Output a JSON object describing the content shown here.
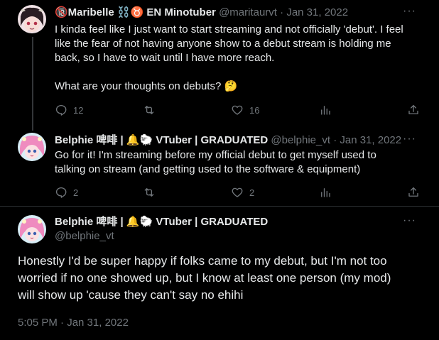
{
  "tweets": [
    {
      "display_name": "🔞Maribelle ⛓️♉ EN Minotuber",
      "handle": "@maritaurvt",
      "date": "Jan 31, 2022",
      "text_lines": [
        "I kinda feel like I just want to start streaming and not officially 'debut'. I feel",
        "like the fear of not having anyone show to a debut stream is holding me",
        "back, so I have to wait until I have more reach."
      ],
      "text_line2": "What are your thoughts on debuts? 🤔",
      "replies": "12",
      "retweets": "",
      "likes": "16",
      "views": ""
    },
    {
      "display_name": "Belphie 啤啡 | 🔔🐑 VTuber | GRADUATED",
      "handle": "@belphie_vt",
      "date": "Jan 31, 2022",
      "text_lines": [
        "Go for it! I'm streaming before my official debut to get myself used to",
        "talking on stream (and getting used to the software & equipment)"
      ],
      "replies": "2",
      "retweets": "",
      "likes": "2",
      "views": ""
    }
  ],
  "main_tweet": {
    "display_name": "Belphie 啤啡 | 🔔🐑 VTuber | GRADUATED",
    "handle": "@belphie_vt",
    "text_lines": [
      "Honestly I'd be super happy if folks came to my debut, but I'm not too",
      "worried if no one showed up, but I know at least one person (my mod)",
      "will show up 'cause they can't say no ehihi"
    ],
    "timestamp": "5:05 PM · Jan 31, 2022"
  },
  "colors": {
    "background": "#000000",
    "text": "#e7e9ea",
    "muted": "#71767b",
    "divider": "#2f3336"
  }
}
